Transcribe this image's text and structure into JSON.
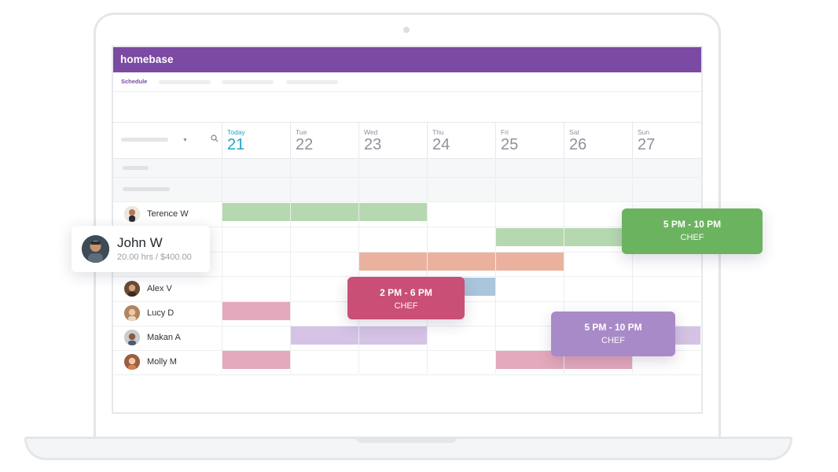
{
  "app": {
    "brand": "homebase",
    "nav_active": "Schedule"
  },
  "colors": {
    "brand": "#7b4aa2",
    "today": "#1fa5c9",
    "green": "#6cb35f",
    "pink": "#c94f77",
    "purple": "#a88ac8"
  },
  "days": [
    {
      "label": "Today",
      "number": "21"
    },
    {
      "label": "Tue",
      "number": "22"
    },
    {
      "label": "Wed",
      "number": "23"
    },
    {
      "label": "Thu",
      "number": "24"
    },
    {
      "label": "Fri",
      "number": "25"
    },
    {
      "label": "Sat",
      "number": "26"
    },
    {
      "label": "Sun",
      "number": "27"
    }
  ],
  "employees": [
    {
      "name": "Terence W",
      "avatar": "avatar-terence"
    },
    {
      "name": "",
      "avatar": ""
    },
    {
      "name": "",
      "avatar": ""
    },
    {
      "name": "Alex V",
      "avatar": "avatar-alex"
    },
    {
      "name": "Lucy D",
      "avatar": "avatar-lucy"
    },
    {
      "name": "Makan A",
      "avatar": "avatar-makan"
    },
    {
      "name": "Molly M",
      "avatar": "avatar-molly"
    }
  ],
  "person_card": {
    "name": "John W",
    "meta": "20.00 hrs / $400.00"
  },
  "shift_cards": [
    {
      "time": "5 PM - 10 PM",
      "role": "CHEF",
      "color": "#6cb35f"
    },
    {
      "time": "2 PM - 6 PM",
      "role": "CHEF",
      "color": "#c94f77"
    },
    {
      "time": "5 PM - 10 PM",
      "role": "CHEF",
      "color": "#a88ac8"
    }
  ]
}
